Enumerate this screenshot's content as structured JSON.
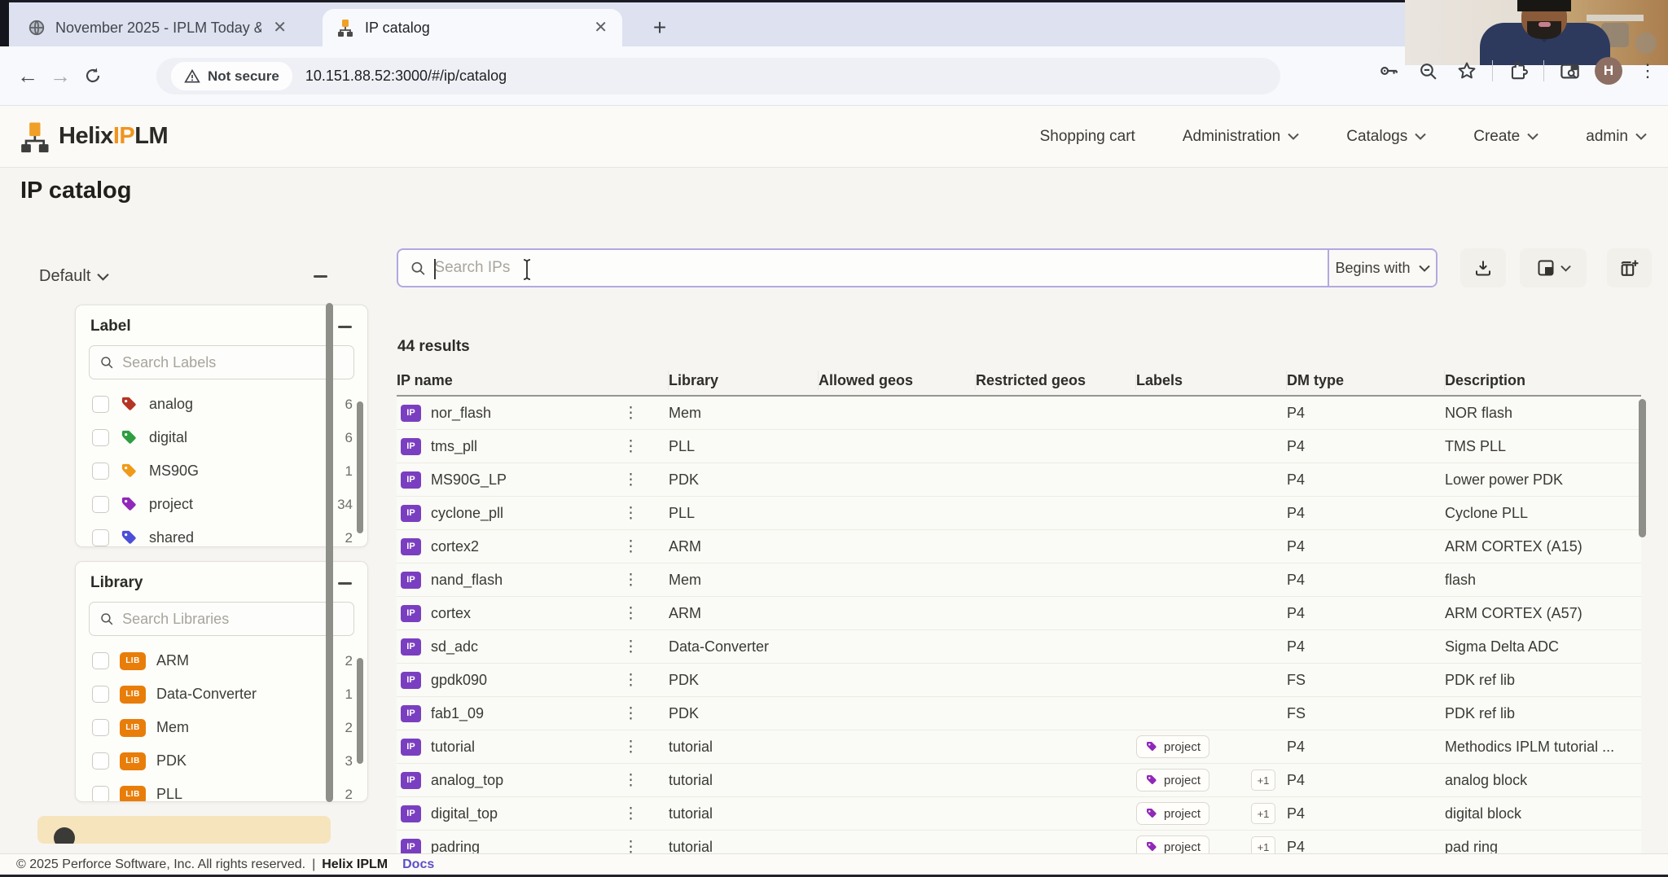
{
  "browser": {
    "window_tabs": [
      {
        "title": "November 2025 - IPLM Today &"
      },
      {
        "title": "IP catalog"
      }
    ],
    "security_label": "Not secure",
    "url": "10.151.88.52:3000/#/ip/catalog",
    "profile_initial": "H"
  },
  "app_header": {
    "brand": {
      "prefix": "Helix",
      "accent": "IP",
      "suffix": "LM"
    },
    "nav": [
      {
        "label": "Shopping cart",
        "dropdown": false
      },
      {
        "label": "Administration",
        "dropdown": true
      },
      {
        "label": "Catalogs",
        "dropdown": true
      },
      {
        "label": "Create",
        "dropdown": true
      },
      {
        "label": "admin",
        "dropdown": true
      }
    ]
  },
  "page": {
    "title": "IP catalog"
  },
  "sidebar": {
    "preset_label": "Default",
    "sections": [
      {
        "title": "Label",
        "search_placeholder": "Search Labels",
        "icon_type": "tag",
        "items": [
          {
            "name": "analog",
            "count": "6",
            "color": "#b53423"
          },
          {
            "name": "digital",
            "count": "6",
            "color": "#2f9e41"
          },
          {
            "name": "MS90G",
            "count": "1",
            "color": "#f09a1a"
          },
          {
            "name": "project",
            "count": "34",
            "color": "#9128b8"
          },
          {
            "name": "shared",
            "count": "2",
            "color": "#4b4fd8"
          }
        ]
      },
      {
        "title": "Library",
        "search_placeholder": "Search Libraries",
        "icon_type": "lib",
        "items": [
          {
            "name": "ARM",
            "count": "2"
          },
          {
            "name": "Data-Converter",
            "count": "1"
          },
          {
            "name": "Mem",
            "count": "2"
          },
          {
            "name": "PDK",
            "count": "3"
          },
          {
            "name": "PLL",
            "count": "2"
          }
        ]
      }
    ]
  },
  "search": {
    "placeholder": "Search IPs",
    "match_mode": "Begins with"
  },
  "results": {
    "count_text": "44 results"
  },
  "table": {
    "columns": [
      "IP name",
      "Library",
      "Allowed geos",
      "Restricted geos",
      "Labels",
      "DM type",
      "Description"
    ],
    "rows": [
      {
        "ip": "nor_flash",
        "library": "Mem",
        "labels": [],
        "more": "",
        "dm_type": "P4",
        "description": "NOR flash"
      },
      {
        "ip": "tms_pll",
        "library": "PLL",
        "labels": [],
        "more": "",
        "dm_type": "P4",
        "description": "TMS PLL"
      },
      {
        "ip": "MS90G_LP",
        "library": "PDK",
        "labels": [],
        "more": "",
        "dm_type": "P4",
        "description": "Lower power PDK"
      },
      {
        "ip": "cyclone_pll",
        "library": "PLL",
        "labels": [],
        "more": "",
        "dm_type": "P4",
        "description": "Cyclone PLL"
      },
      {
        "ip": "cortex2",
        "library": "ARM",
        "labels": [],
        "more": "",
        "dm_type": "P4",
        "description": "ARM CORTEX (A15)"
      },
      {
        "ip": "nand_flash",
        "library": "Mem",
        "labels": [],
        "more": "",
        "dm_type": "P4",
        "description": "flash"
      },
      {
        "ip": "cortex",
        "library": "ARM",
        "labels": [],
        "more": "",
        "dm_type": "P4",
        "description": "ARM CORTEX (A57)"
      },
      {
        "ip": "sd_adc",
        "library": "Data-Converter",
        "labels": [],
        "more": "",
        "dm_type": "P4",
        "description": "Sigma Delta ADC"
      },
      {
        "ip": "gpdk090",
        "library": "PDK",
        "labels": [],
        "more": "",
        "dm_type": "FS",
        "description": "PDK ref lib"
      },
      {
        "ip": "fab1_09",
        "library": "PDK",
        "labels": [],
        "more": "",
        "dm_type": "FS",
        "description": "PDK ref lib"
      },
      {
        "ip": "tutorial",
        "library": "tutorial",
        "labels": [
          "project"
        ],
        "more": "",
        "dm_type": "P4",
        "description": "Methodics IPLM tutorial ..."
      },
      {
        "ip": "analog_top",
        "library": "tutorial",
        "labels": [
          "project"
        ],
        "more": "+1",
        "dm_type": "P4",
        "description": "analog block"
      },
      {
        "ip": "digital_top",
        "library": "tutorial",
        "labels": [
          "project"
        ],
        "more": "+1",
        "dm_type": "P4",
        "description": "digital block"
      },
      {
        "ip": "padring",
        "library": "tutorial",
        "labels": [
          "project"
        ],
        "more": "+1",
        "dm_type": "P4",
        "description": "pad ring"
      }
    ]
  },
  "footer": {
    "copyright": "© 2025 Perforce Software, Inc. All rights reserved.",
    "separator": "|",
    "product": "Helix IPLM",
    "docs": "Docs"
  },
  "colors": {
    "ip_badge": "#7a3fc0",
    "lib_badge": "#e87d09",
    "label_chip_tag": "#9128b8",
    "docs_link": "#5a50c8",
    "logo_orange": "#f0941f",
    "focus_border": "#b3a8e0"
  }
}
